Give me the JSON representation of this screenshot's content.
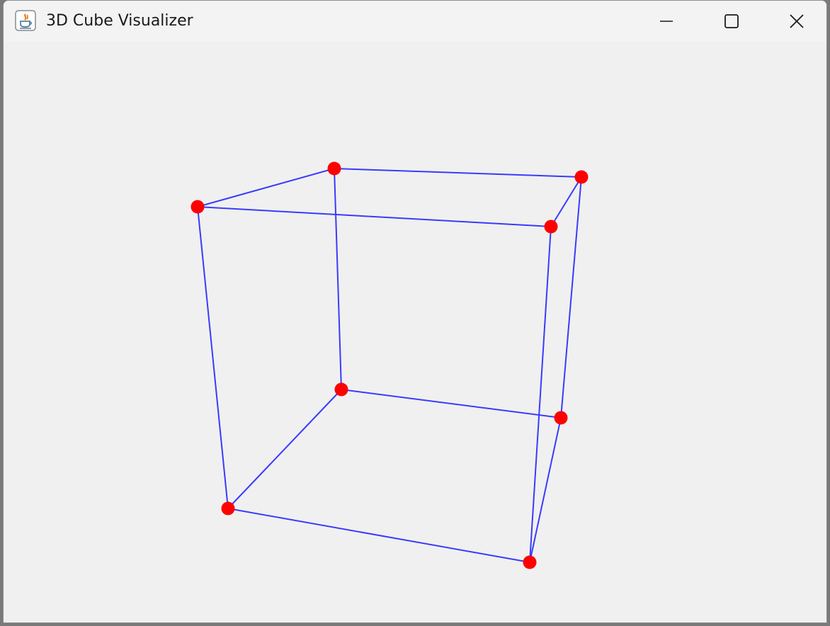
{
  "window": {
    "title": "3D Cube Visualizer"
  },
  "icons": {
    "app": "java-app-icon",
    "minimize": "minimize-icon",
    "maximize": "maximize-icon",
    "close": "close-icon"
  },
  "colors": {
    "edge": "#3a3aff",
    "vertex": "#ff0000",
    "background": "#f0f0f0"
  }
}
